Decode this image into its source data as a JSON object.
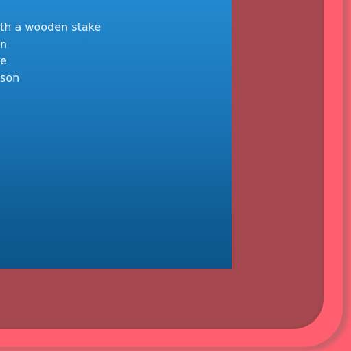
{
  "panel": {
    "lines": [
      "th a wooden stake",
      "n",
      "e",
      "son"
    ]
  },
  "colors": {
    "outer_border": "#ff5f6e",
    "inner_border": "#a5474f",
    "panel_top": "#2389cf",
    "panel_bottom": "#0b5589",
    "text": "#e9f4fc"
  }
}
